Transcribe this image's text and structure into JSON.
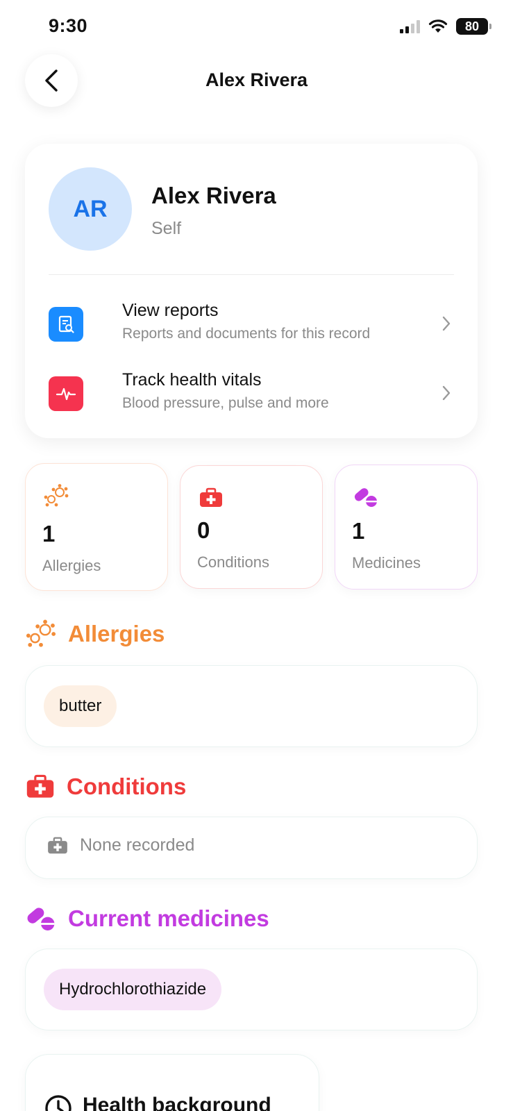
{
  "status_bar": {
    "time": "9:30",
    "battery": "80"
  },
  "header": {
    "title": "Alex Rivera"
  },
  "profile": {
    "initials": "AR",
    "name": "Alex Rivera",
    "relation": "Self",
    "actions": [
      {
        "title": "View reports",
        "subtitle": "Reports and documents for this record",
        "icon": "document-search-icon",
        "color": "#1a8cff"
      },
      {
        "title": "Track health vitals",
        "subtitle": "Blood pressure, pulse and more",
        "icon": "heartbeat-icon",
        "color": "#f5334f"
      }
    ]
  },
  "stats": [
    {
      "value": "1",
      "label": "Allergies",
      "icon": "allergen-icon",
      "color": "#f28c38",
      "border": "#fde3d6"
    },
    {
      "value": "0",
      "label": "Conditions",
      "icon": "medical-kit-icon",
      "color": "#ef3b3b",
      "border": "#fbd6d6"
    },
    {
      "value": "1",
      "label": "Medicines",
      "icon": "pills-icon",
      "color": "#c23be0",
      "border": "#f1d6f7"
    }
  ],
  "sections": {
    "allergies": {
      "title": "Allergies",
      "color": "#f28c38",
      "items": [
        "butter"
      ],
      "chip_bg": "#fdf0e4"
    },
    "conditions": {
      "title": "Conditions",
      "color": "#ef3b3b",
      "empty_text": "None recorded"
    },
    "medicines": {
      "title": "Current medicines",
      "color": "#c23be0",
      "items": [
        "Hydrochlorothiazide"
      ],
      "chip_bg": "#f7e4f8"
    },
    "health_background": {
      "title": "Health background"
    }
  }
}
